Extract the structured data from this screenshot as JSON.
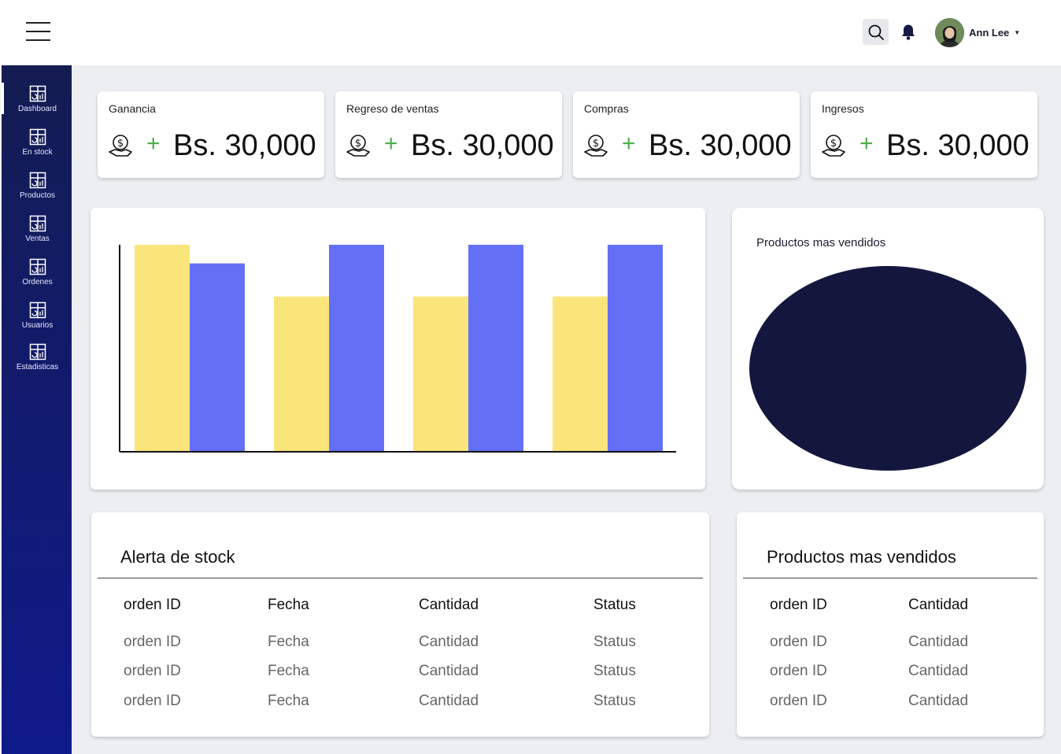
{
  "header": {
    "user_name": "Ann Lee"
  },
  "sidebar": {
    "items": [
      {
        "label": "Dashboard"
      },
      {
        "label": "En stock"
      },
      {
        "label": "Productos"
      },
      {
        "label": "Ventas"
      },
      {
        "label": "Ordenes"
      },
      {
        "label": "Usuarios"
      },
      {
        "label": "Estadisticas"
      }
    ]
  },
  "stats": [
    {
      "title": "Ganancia",
      "plus": "+",
      "value": "Bs. 30,000"
    },
    {
      "title": "Regreso de ventas",
      "plus": "+",
      "value": "Bs. 30,000"
    },
    {
      "title": "Compras",
      "plus": "+",
      "value": "Bs. 30,000"
    },
    {
      "title": "Ingresos",
      "plus": "+",
      "value": "Bs. 30,000"
    }
  ],
  "chart_data": {
    "type": "bar",
    "categories": [
      "",
      "",
      "",
      ""
    ],
    "series": [
      {
        "color": "#fae57a",
        "values": [
          100,
          75,
          75,
          75
        ]
      },
      {
        "color": "#6370f5",
        "values": [
          91,
          100,
          100,
          100
        ]
      }
    ],
    "ylim": [
      0,
      100
    ],
    "grid": false
  },
  "pie": {
    "title": "Productos mas vendidos",
    "color": "#14173d"
  },
  "stock_alert": {
    "title": "Alerta de stock",
    "headers": [
      "orden ID",
      "Fecha",
      "Cantidad",
      "Status"
    ],
    "rows": [
      [
        "orden ID",
        "Fecha",
        "Cantidad",
        "Status"
      ],
      [
        "orden ID",
        "Fecha",
        "Cantidad",
        "Status"
      ],
      [
        "orden ID",
        "Fecha",
        "Cantidad",
        "Status"
      ]
    ]
  },
  "top_products": {
    "title": "Productos mas vendidos",
    "headers": [
      "orden ID",
      "Cantidad"
    ],
    "rows": [
      [
        "orden ID",
        "Cantidad"
      ],
      [
        "orden ID",
        "Cantidad"
      ],
      [
        "orden ID",
        "Cantidad"
      ]
    ]
  },
  "colors": {
    "sidebar_top": "#141c52",
    "sidebar_bottom": "#0f1a8a",
    "accent_green": "#4cae4c",
    "bar_yellow": "#fae57a",
    "bar_blue": "#6370f5",
    "pie_navy": "#14173d"
  }
}
